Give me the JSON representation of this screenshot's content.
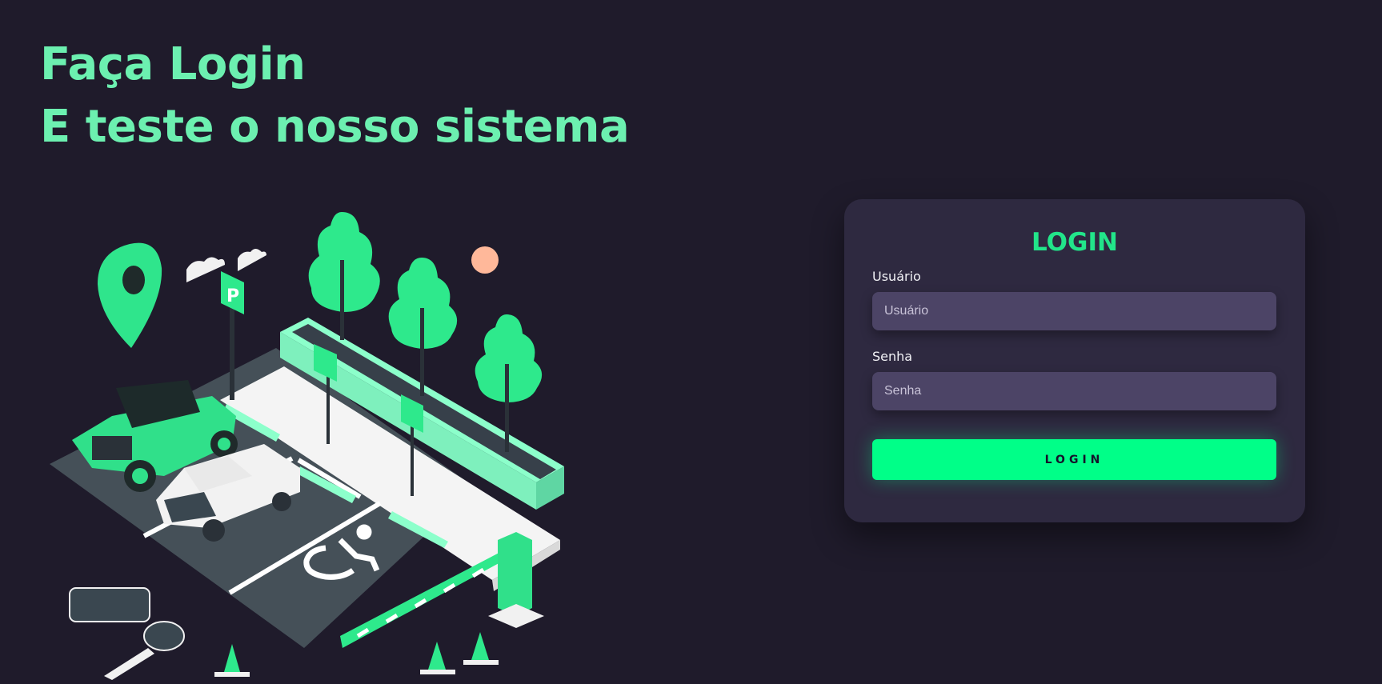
{
  "hero": {
    "line1": "Faça Login",
    "line2": "E teste o nosso sistema"
  },
  "illustration": {
    "sign_letter": "P"
  },
  "login": {
    "title": "LOGIN",
    "username_label": "Usuário",
    "username_placeholder": "Usuário",
    "username_value": "",
    "password_label": "Senha",
    "password_placeholder": "Senha",
    "password_value": "",
    "submit_label": "LOGIN"
  },
  "colors": {
    "background": "#1f1b2b",
    "card": "#2e2940",
    "accent": "#00ff88",
    "headline": "#6cf0b0",
    "input": "#4c4466"
  },
  "icons": [
    "location-pin-icon",
    "parking-sign-icon",
    "wheelchair-icon",
    "car-key-icon",
    "traffic-cone-icon"
  ]
}
